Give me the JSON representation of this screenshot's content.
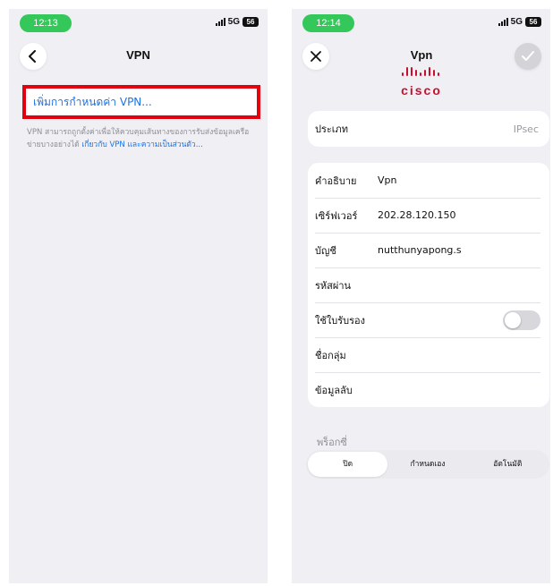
{
  "left_screen": {
    "status": {
      "time": "12:13",
      "network": "5G",
      "battery": "56"
    },
    "nav": {
      "title": "VPN"
    },
    "add_vpn_label": "เพิ่มการกำหนดค่า VPN...",
    "note_text": "VPN สามารถถูกตั้งค่าเพื่อให้ควบคุมเส้นทางของการรับส่งข้อมูลเครือข่ายบางอย่างได้",
    "note_link": "เกี่ยวกับ VPN และความเป็นส่วนตัว..."
  },
  "right_screen": {
    "status": {
      "time": "12:14",
      "network": "5G",
      "battery": "56"
    },
    "nav": {
      "title": "Vpn",
      "logo_text": "cisco"
    },
    "type_row": {
      "label": "ประเภท",
      "value": "IPsec"
    },
    "fields": {
      "description": {
        "label": "คำอธิบาย",
        "value": "Vpn"
      },
      "server": {
        "label": "เซิร์ฟเวอร์",
        "value": "202.28.120.150"
      },
      "account": {
        "label": "บัญชี",
        "value": "nutthunyapong.s"
      },
      "password": {
        "label": "รหัสผ่าน",
        "value": ""
      },
      "use_certificate": {
        "label": "ใช้ใบรับรอง",
        "enabled": false
      },
      "group_name": {
        "label": "ชื่อกลุ่ม",
        "value": ""
      },
      "secret": {
        "label": "ข้อมูลลับ",
        "value": ""
      }
    },
    "proxy": {
      "label": "พร็อกซี่",
      "options": [
        "ปิด",
        "กำหนดเอง",
        "อัตโนมัติ"
      ],
      "selected": "ปิด"
    }
  },
  "colors": {
    "accent_blue": "#1b73e8",
    "status_green": "#34c759",
    "highlight_red": "#e3000f",
    "cisco_red": "#c8102e"
  }
}
